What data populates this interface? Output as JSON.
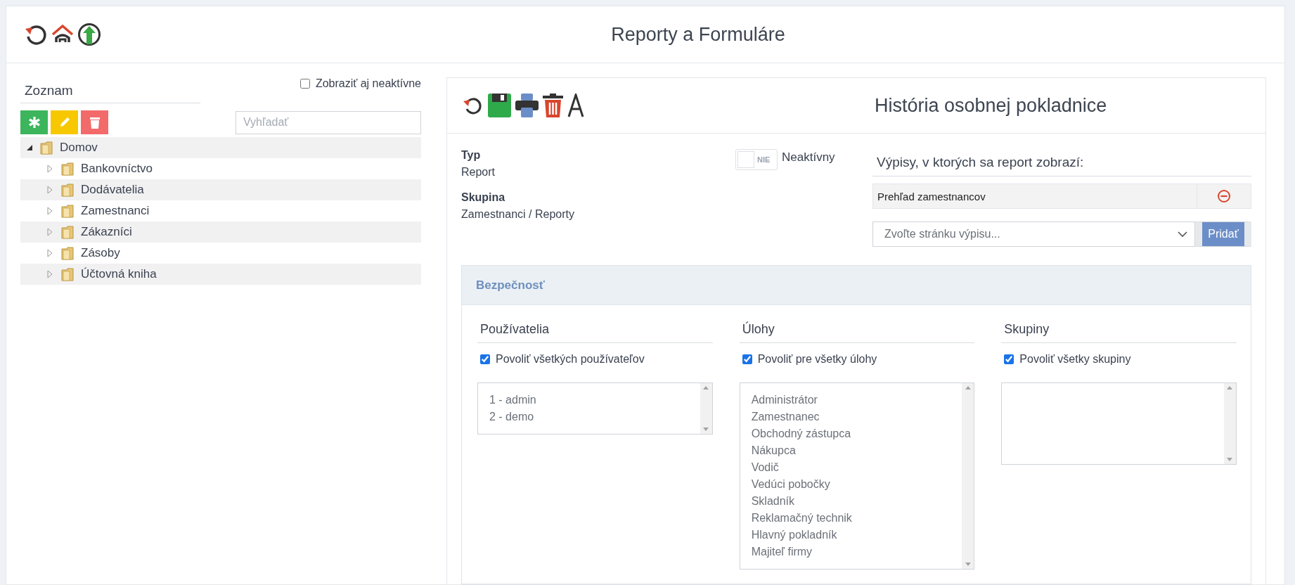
{
  "header": {
    "title": "Reporty a Formuláre",
    "tools": [
      {
        "kind": "refresh"
      },
      {
        "kind": "home"
      },
      {
        "kind": "upload"
      }
    ]
  },
  "list": {
    "title": "Zoznam",
    "show_inactive": {
      "label": "Zobraziť aj neaktívne",
      "checked": false
    },
    "actions": [
      {
        "kind": "add"
      },
      {
        "kind": "edit"
      },
      {
        "kind": "delete"
      }
    ],
    "search": {
      "placeholder": "Vyhľadať"
    },
    "tree": [
      {
        "label": "Domov",
        "expanded": true,
        "children": [
          {
            "label": "Bankovníctvo",
            "expanded": false
          },
          {
            "label": "Dodávatelia",
            "expanded": false
          },
          {
            "label": "Zamestnanci",
            "expanded": false
          },
          {
            "label": "Zákazníci",
            "expanded": false
          },
          {
            "label": "Zásoby",
            "expanded": false
          },
          {
            "label": "Účtovná kniha",
            "expanded": false
          }
        ]
      }
    ]
  },
  "detail": {
    "tools": [
      {
        "kind": "refresh"
      },
      {
        "kind": "save"
      },
      {
        "kind": "print"
      },
      {
        "kind": "delete"
      },
      {
        "kind": "font"
      }
    ],
    "title": "História osobnej pokladnice",
    "fields": [
      {
        "label": "Typ",
        "value": "Report"
      },
      {
        "label": "Skupina",
        "value": "Zamestnanci / Reporty"
      }
    ],
    "inactive_toggle": {
      "on": false,
      "state_label": "NIE",
      "label": "Neaktívny"
    },
    "listings": {
      "title": "Výpisy, v ktorých sa report zobrazí:",
      "items": [
        "Prehľad zamestnancov"
      ],
      "select": {
        "placeholder": "Zvoľte stránku výpisu..."
      },
      "add_button": "Pridať"
    },
    "security": {
      "title": "Bezpečnosť",
      "columns": [
        {
          "title": "Používatelia",
          "allow_all": {
            "label": "Povoliť všetkých používateľov",
            "checked": true
          },
          "options": [
            "1 - admin",
            "2 - demo"
          ]
        },
        {
          "title": "Úlohy",
          "allow_all": {
            "label": "Povoliť pre všetky úlohy",
            "checked": true
          },
          "options": [
            "Administrátor",
            "Zamestnanec",
            "Obchodný zástupca",
            "Nákupca",
            "Vodič",
            "Vedúci pobočky",
            "Skladník",
            "Reklamačný technik",
            "Hlavný pokladník",
            "Majiteľ firmy"
          ]
        },
        {
          "title": "Skupiny",
          "allow_all": {
            "label": "Povoliť všetky skupiny",
            "checked": true
          }
        }
      ]
    }
  }
}
